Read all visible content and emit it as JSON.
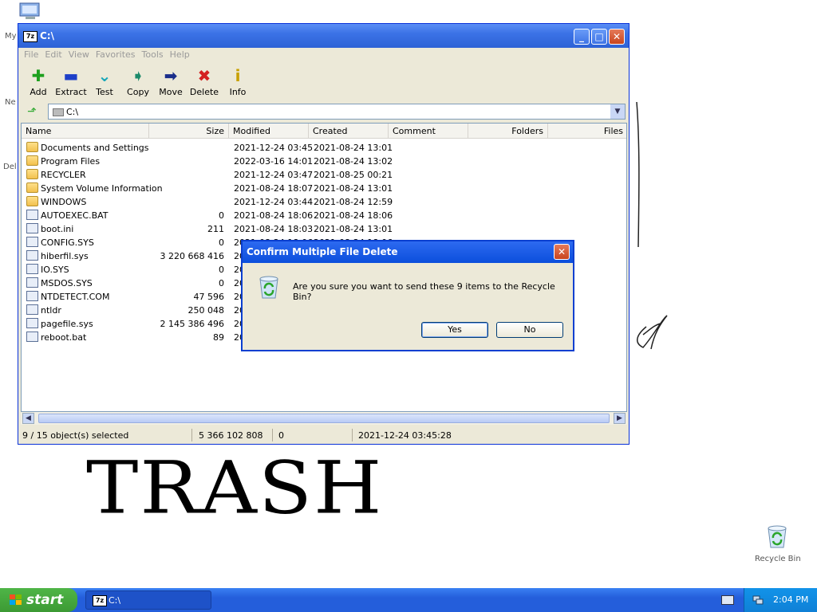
{
  "desktop": {
    "icon_labels": [
      "My",
      "Ne",
      "Del"
    ],
    "recycle_bin_label": "Recycle Bin",
    "overlay_text": "TRASH"
  },
  "window": {
    "app_icon_text": "7z",
    "title": "C:\\",
    "menu": [
      "File",
      "Edit",
      "View",
      "Favorites",
      "Tools",
      "Help"
    ],
    "toolbar": [
      {
        "label": "Add",
        "icon": "add-icon"
      },
      {
        "label": "Extract",
        "icon": "extract-icon"
      },
      {
        "label": "Test",
        "icon": "test-icon"
      },
      {
        "label": "Copy",
        "icon": "copy-icon"
      },
      {
        "label": "Move",
        "icon": "move-icon"
      },
      {
        "label": "Delete",
        "icon": "delete-icon"
      },
      {
        "label": "Info",
        "icon": "info-icon"
      }
    ],
    "address": "C:\\",
    "columns": [
      "Name",
      "Size",
      "Modified",
      "Created",
      "Comment",
      "Folders",
      "Files"
    ],
    "rows": [
      {
        "name": "Documents and Settings",
        "size": "",
        "modified": "2021-12-24 03:45",
        "created": "2021-08-24 13:01",
        "type": "folder"
      },
      {
        "name": "Program Files",
        "size": "",
        "modified": "2022-03-16 14:01",
        "created": "2021-08-24 13:02",
        "type": "folder"
      },
      {
        "name": "RECYCLER",
        "size": "",
        "modified": "2021-12-24 03:47",
        "created": "2021-08-25 00:21",
        "type": "folder"
      },
      {
        "name": "System Volume Information",
        "size": "",
        "modified": "2021-08-24 18:07",
        "created": "2021-08-24 13:01",
        "type": "folder"
      },
      {
        "name": "WINDOWS",
        "size": "",
        "modified": "2021-12-24 03:44",
        "created": "2021-08-24 12:59",
        "type": "folder"
      },
      {
        "name": "AUTOEXEC.BAT",
        "size": "0",
        "modified": "2021-08-24 18:06",
        "created": "2021-08-24 18:06",
        "type": "file"
      },
      {
        "name": "boot.ini",
        "size": "211",
        "modified": "2021-08-24 18:03",
        "created": "2021-08-24 13:01",
        "type": "file"
      },
      {
        "name": "CONFIG.SYS",
        "size": "0",
        "modified": "2021-08-24 18:06",
        "created": "2021-08-24 18:06",
        "type": "file"
      },
      {
        "name": "hiberfil.sys",
        "size": "3 220 668 416",
        "modified": "20",
        "created": "",
        "type": "file"
      },
      {
        "name": "IO.SYS",
        "size": "0",
        "modified": "20",
        "created": "",
        "type": "file"
      },
      {
        "name": "MSDOS.SYS",
        "size": "0",
        "modified": "20",
        "created": "",
        "type": "file"
      },
      {
        "name": "NTDETECT.COM",
        "size": "47 596",
        "modified": "20",
        "created": "",
        "type": "file"
      },
      {
        "name": "ntldr",
        "size": "250 048",
        "modified": "20",
        "created": "",
        "type": "file"
      },
      {
        "name": "pagefile.sys",
        "size": "2 145 386 496",
        "modified": "20",
        "created": "",
        "type": "file"
      },
      {
        "name": "reboot.bat",
        "size": "89",
        "modified": "20",
        "created": "",
        "type": "file"
      }
    ],
    "status": {
      "selection": "9 / 15 object(s) selected",
      "total_size": "5 366 102 808",
      "packed": "0",
      "date": "2021-12-24 03:45:28"
    }
  },
  "dialog": {
    "title": "Confirm Multiple File Delete",
    "message": "Are you sure you want to send these 9 items to the Recycle Bin?",
    "yes_label": "Yes",
    "no_label": "No"
  },
  "taskbar": {
    "start_label": "start",
    "task_icon_text": "7z",
    "task_label": "C:\\",
    "clock": "2:04 PM"
  }
}
